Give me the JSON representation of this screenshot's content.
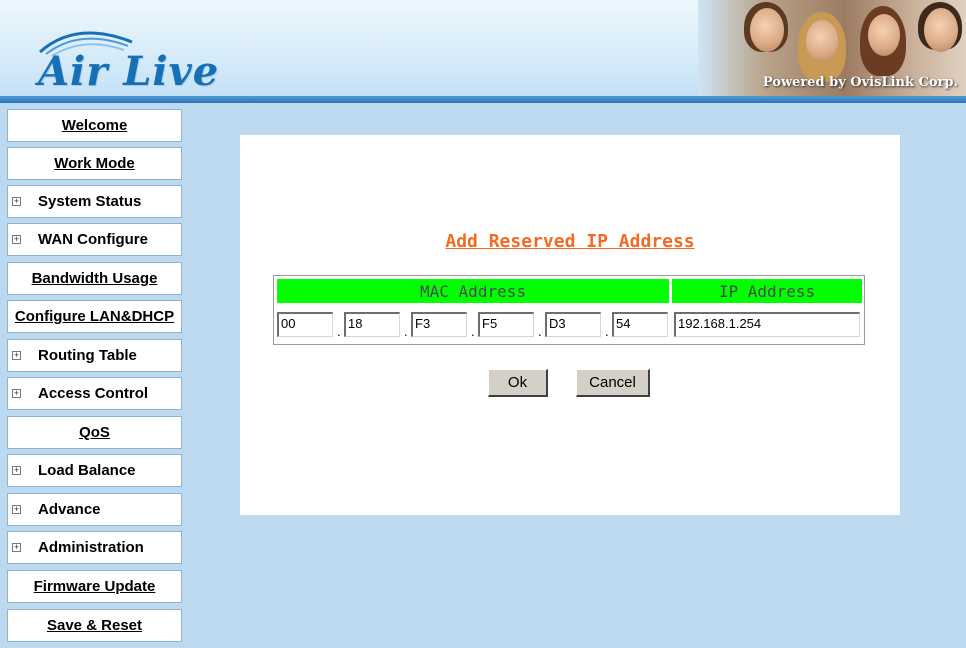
{
  "header": {
    "logo_text": "Air Live",
    "powered_by": "Powered by OvisLink Corp."
  },
  "sidebar": {
    "items": [
      {
        "label": "Welcome",
        "type": "link"
      },
      {
        "label": "Work Mode",
        "type": "link"
      },
      {
        "label": "System Status",
        "type": "expand"
      },
      {
        "label": "WAN Configure",
        "type": "expand"
      },
      {
        "label": "Bandwidth Usage",
        "type": "link"
      },
      {
        "label": "Configure LAN&DHCP",
        "type": "link"
      },
      {
        "label": "Routing Table",
        "type": "expand"
      },
      {
        "label": "Access Control",
        "type": "expand"
      },
      {
        "label": "QoS",
        "type": "link"
      },
      {
        "label": "Load Balance",
        "type": "expand"
      },
      {
        "label": "Advance",
        "type": "expand"
      },
      {
        "label": "Administration",
        "type": "expand"
      },
      {
        "label": "Firmware Update",
        "type": "link"
      },
      {
        "label": "Save & Reset",
        "type": "link"
      }
    ],
    "expand_icon": "plus-box-icon"
  },
  "form": {
    "title": "Add Reserved IP Address",
    "mac_header": "MAC Address",
    "ip_header": "IP Address",
    "separator": ".",
    "mac_octets": [
      "00",
      "18",
      "F3",
      "F5",
      "D3",
      "54"
    ],
    "ip_value": "192.168.1.254",
    "ok_label": "Ok",
    "cancel_label": "Cancel"
  },
  "colors": {
    "title": "#f26a23",
    "table_header": "#00ff00",
    "background": "#bcd9ef",
    "header_line": "#2b74b8"
  }
}
